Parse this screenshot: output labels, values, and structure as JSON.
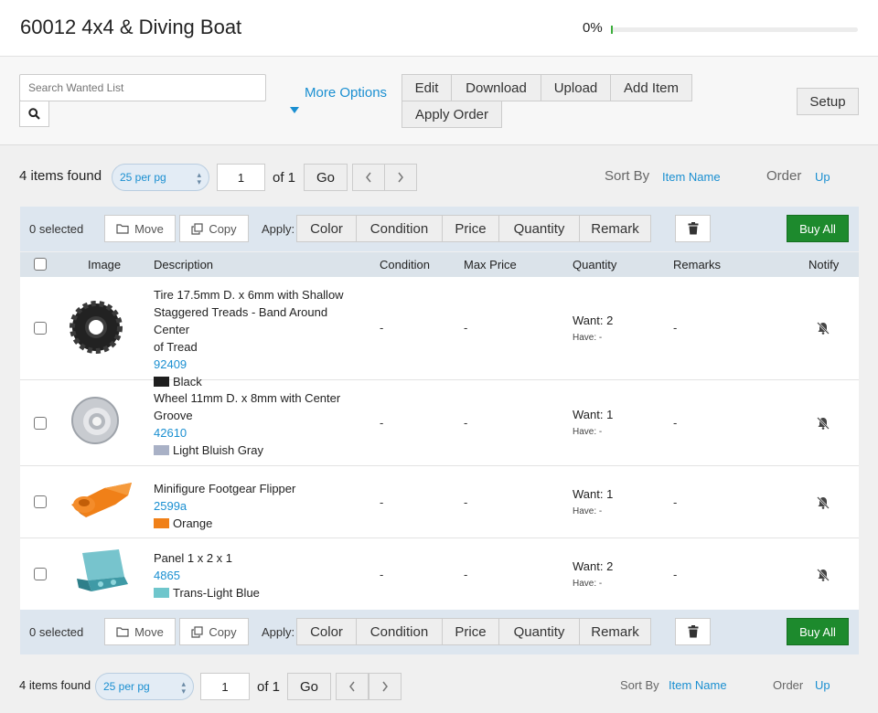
{
  "header": {
    "title": "60012 4x4 & Diving Boat",
    "progress_label": "0%",
    "progress_fraction": 0.0
  },
  "toolbar": {
    "search_placeholder": "Search Wanted List",
    "more_options": "More Options",
    "edit": "Edit",
    "download": "Download",
    "upload": "Upload",
    "add_item": "Add Item",
    "apply_order": "Apply Order",
    "setup": "Setup"
  },
  "pager": {
    "found": "4 items found",
    "per_page": "25 per pg",
    "page": "1",
    "of": "of 1",
    "go": "Go",
    "sort_by": "Sort By",
    "sort_value": "Item Name",
    "order": "Order",
    "order_value": "Up"
  },
  "actions": {
    "selected": "0 selected",
    "move": "Move",
    "copy": "Copy",
    "apply": "Apply:",
    "color": "Color",
    "condition": "Condition",
    "price": "Price",
    "quantity": "Quantity",
    "remark": "Remark",
    "buy_all": "Buy All"
  },
  "table": {
    "headers": {
      "image": "Image",
      "description": "Description",
      "condition": "Condition",
      "max_price": "Max Price",
      "quantity": "Quantity",
      "remarks": "Remarks",
      "notify": "Notify"
    },
    "rows": [
      {
        "desc_lines": [
          "Tire 17.5mm D. x 6mm with Shallow",
          "Staggered Treads - Band Around Center",
          "of Tread"
        ],
        "part_no": "92409",
        "color_name": "Black",
        "color_hex": "#1e1e1e",
        "condition": "-",
        "max_price": "-",
        "want": "Want: 2",
        "have": "Have: -",
        "remarks": "-"
      },
      {
        "desc_lines": [
          "Wheel 11mm D. x 8mm with Center",
          "Groove"
        ],
        "part_no": "42610",
        "color_name": "Light Bluish Gray",
        "color_hex": "#a9b1c6",
        "condition": "-",
        "max_price": "-",
        "want": "Want: 1",
        "have": "Have: -",
        "remarks": "-"
      },
      {
        "desc_lines": [
          "Minifigure Footgear Flipper"
        ],
        "part_no": "2599a",
        "color_name": "Orange",
        "color_hex": "#f08018",
        "condition": "-",
        "max_price": "-",
        "want": "Want: 1",
        "have": "Have: -",
        "remarks": "-"
      },
      {
        "desc_lines": [
          "Panel 1 x 2 x 1"
        ],
        "part_no": "4865",
        "color_name": "Trans-Light Blue",
        "color_hex": "#6fc6cc",
        "condition": "-",
        "max_price": "-",
        "want": "Want: 2",
        "have": "Have: -",
        "remarks": "-"
      }
    ]
  },
  "colors": {
    "accent": "#1a8fd1",
    "buy": "#1d8a2d",
    "bar": "#dde6ef"
  }
}
